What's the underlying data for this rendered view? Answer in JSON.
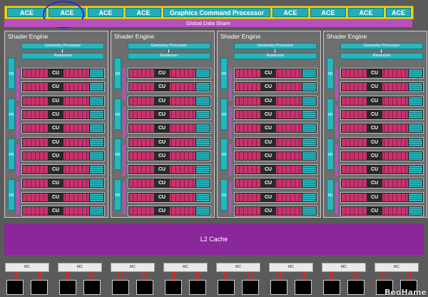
{
  "command_bar": {
    "left_labels": [
      "ACE",
      "ACE",
      "ACE",
      "ACE"
    ],
    "center_label": "Graphics Command Processor",
    "right_labels": [
      "ACE",
      "ACE",
      "ACE",
      "ACE"
    ]
  },
  "global_data_share": "Global Data Share",
  "shader_engine": {
    "title": "Shader Engine",
    "geometry": "Geometry Processor",
    "rasterizer": "Rasterizer",
    "rb_label": "RB",
    "cu_label": "CU",
    "cu_count_per_engine": 11,
    "rb_count_per_engine": 4
  },
  "shader_engine_count": 4,
  "l2_cache": "L2 Cache",
  "memory_controller": {
    "label": "MC",
    "count": 8
  },
  "watermark": "BeoHame",
  "colors": {
    "ace": "#22aeb6",
    "command_bar": "#ecd01c",
    "gds": "#b94fbf",
    "cu": "#c8326e",
    "l2": "#8a279a",
    "highlight": "#1c2fe6"
  }
}
